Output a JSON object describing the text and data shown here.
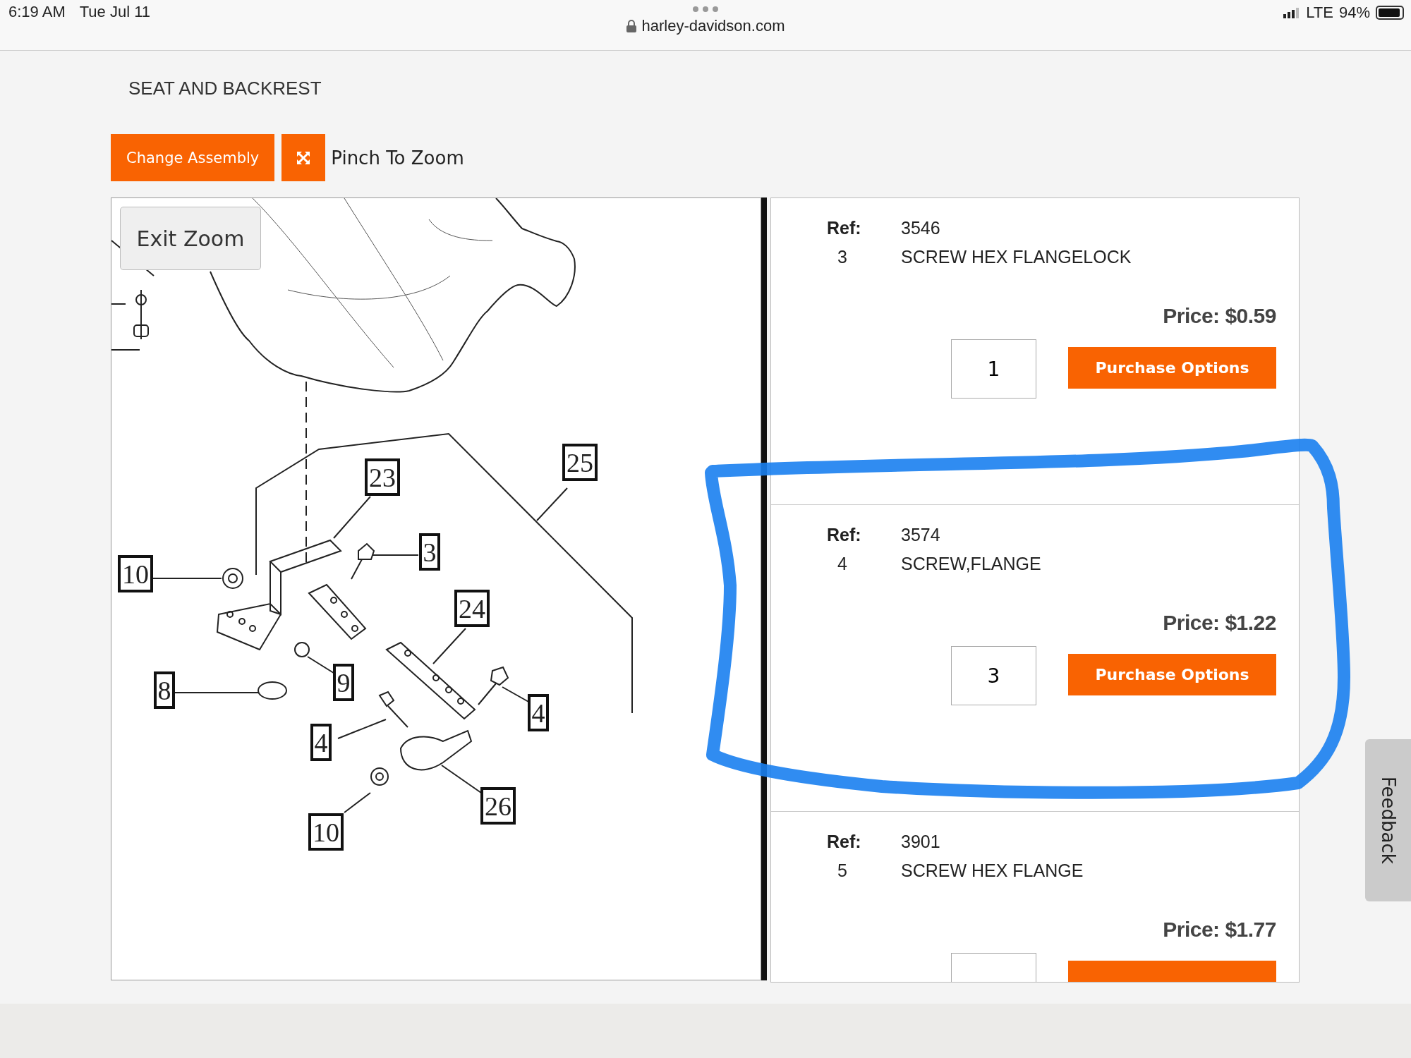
{
  "status_bar": {
    "time": "6:19 AM",
    "date": "Tue Jul 11",
    "url": "harley-davidson.com",
    "network": "LTE",
    "battery": "94%"
  },
  "page_title": "SEAT AND BACKREST",
  "toolbar": {
    "change_button": "Change Assembly",
    "zoom_hint": "Pinch To Zoom"
  },
  "diagram": {
    "exit_button": "Exit Zoom",
    "callouts": [
      {
        "label": "23"
      },
      {
        "label": "25"
      },
      {
        "label": "3"
      },
      {
        "label": "10"
      },
      {
        "label": "24"
      },
      {
        "label": "8"
      },
      {
        "label": "9"
      },
      {
        "label": "4"
      },
      {
        "label": "4"
      },
      {
        "label": "26"
      },
      {
        "label": "10"
      }
    ]
  },
  "parts": [
    {
      "ref_label": "Ref:",
      "ref": "3546",
      "item": "3",
      "description": "SCREW HEX FLANGELOCK",
      "price": "Price: $0.59",
      "quantity": "1",
      "button": "Purchase Options"
    },
    {
      "ref_label": "Ref:",
      "ref": "3574",
      "item": "4",
      "description": "SCREW,FLANGE",
      "price": "Price: $1.22",
      "quantity": "3",
      "button": "Purchase Options"
    },
    {
      "ref_label": "Ref:",
      "ref": "3901",
      "item": "5",
      "description": "SCREW HEX FLANGE",
      "price": "Price: $1.77"
    }
  ],
  "feedback_tab": "Feedback"
}
